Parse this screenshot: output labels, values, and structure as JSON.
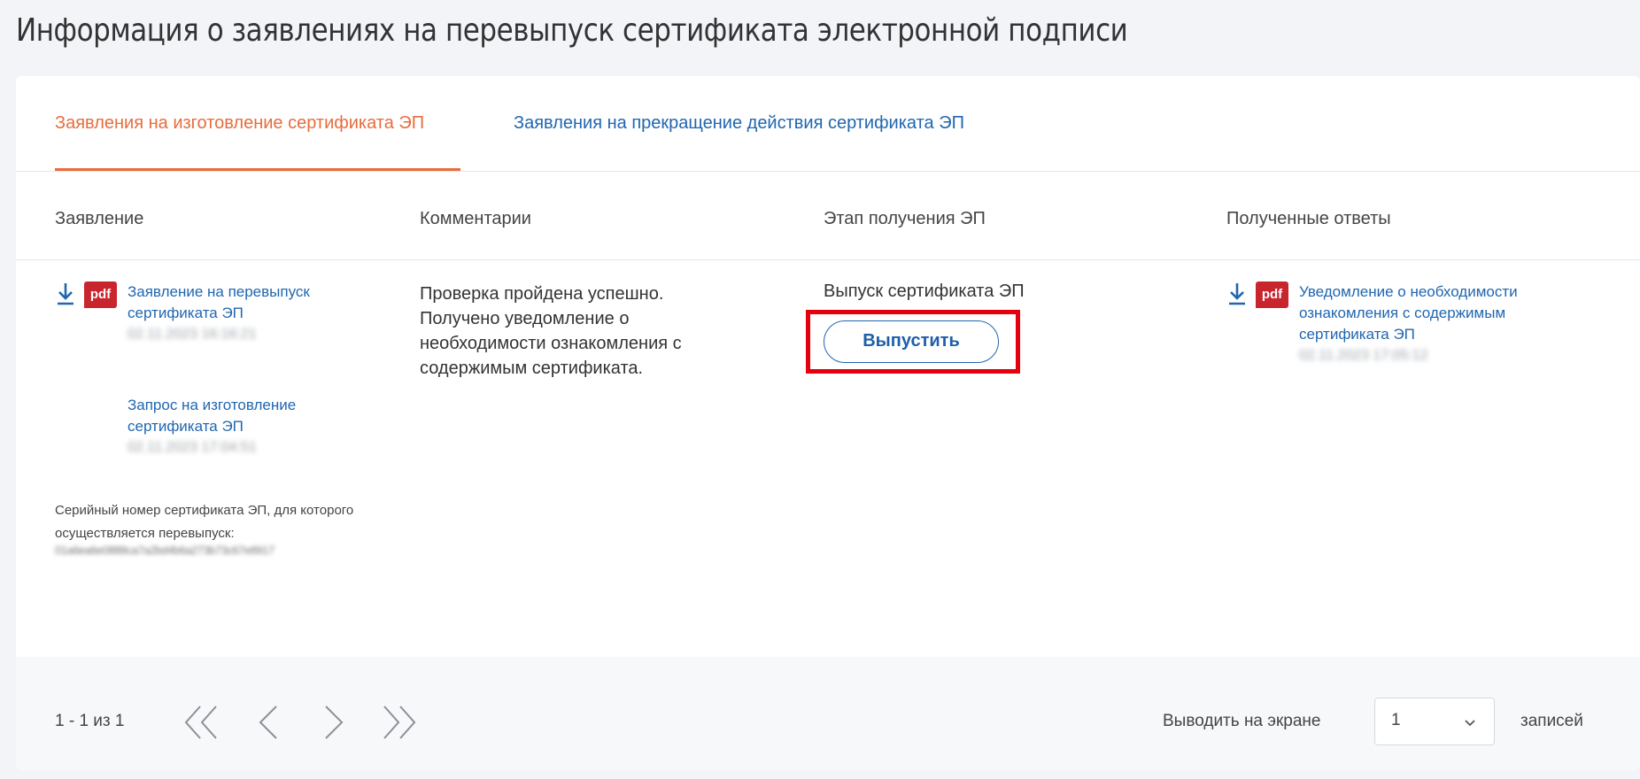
{
  "page": {
    "title": "Информация о заявлениях на перевыпуск сертификата электронной подписи"
  },
  "tabs": [
    {
      "label": "Заявления на изготовление сертификата ЭП",
      "active": true
    },
    {
      "label": "Заявления на прекращение действия сертификата ЭП",
      "active": false
    }
  ],
  "columns": [
    "Заявление",
    "Комментарии",
    "Этап получения ЭП",
    "Полученные ответы"
  ],
  "row": {
    "application": {
      "doc1": {
        "icon": "pdf",
        "title": "Заявление на перевыпуск сертификата ЭП",
        "date": "02.11.2023 16:16:21"
      },
      "doc2": {
        "title": "Запрос на изготовление сертификата ЭП",
        "date": "02.11.2023 17:04:51"
      },
      "serial_label": "Серийный номер сертификата ЭП, для которого осуществляется перевыпуск:",
      "serial_value": "01a6ea6e0888ca7a2bd4b6a273b73c67e8917"
    },
    "comment": "Проверка пройдена успешно. Получено уведомление о необходимости ознакомления с содержимым сертификата.",
    "stage": {
      "text": "Выпуск сертификата ЭП",
      "button_label": "Выпустить"
    },
    "responses": {
      "doc": {
        "icon": "pdf",
        "title": "Уведомление о необходимости ознакомления с содержимым сертификата ЭП",
        "date": "02.11.2023 17:05:12"
      }
    }
  },
  "footer": {
    "range": "1 - 1 из 1",
    "show_label": "Выводить на экране",
    "page_size": "1",
    "records_label": "записей"
  },
  "colors": {
    "accent": "#e86c3c",
    "link": "#2066b0",
    "highlight": "#e5000e",
    "pdf": "#c9252d"
  }
}
